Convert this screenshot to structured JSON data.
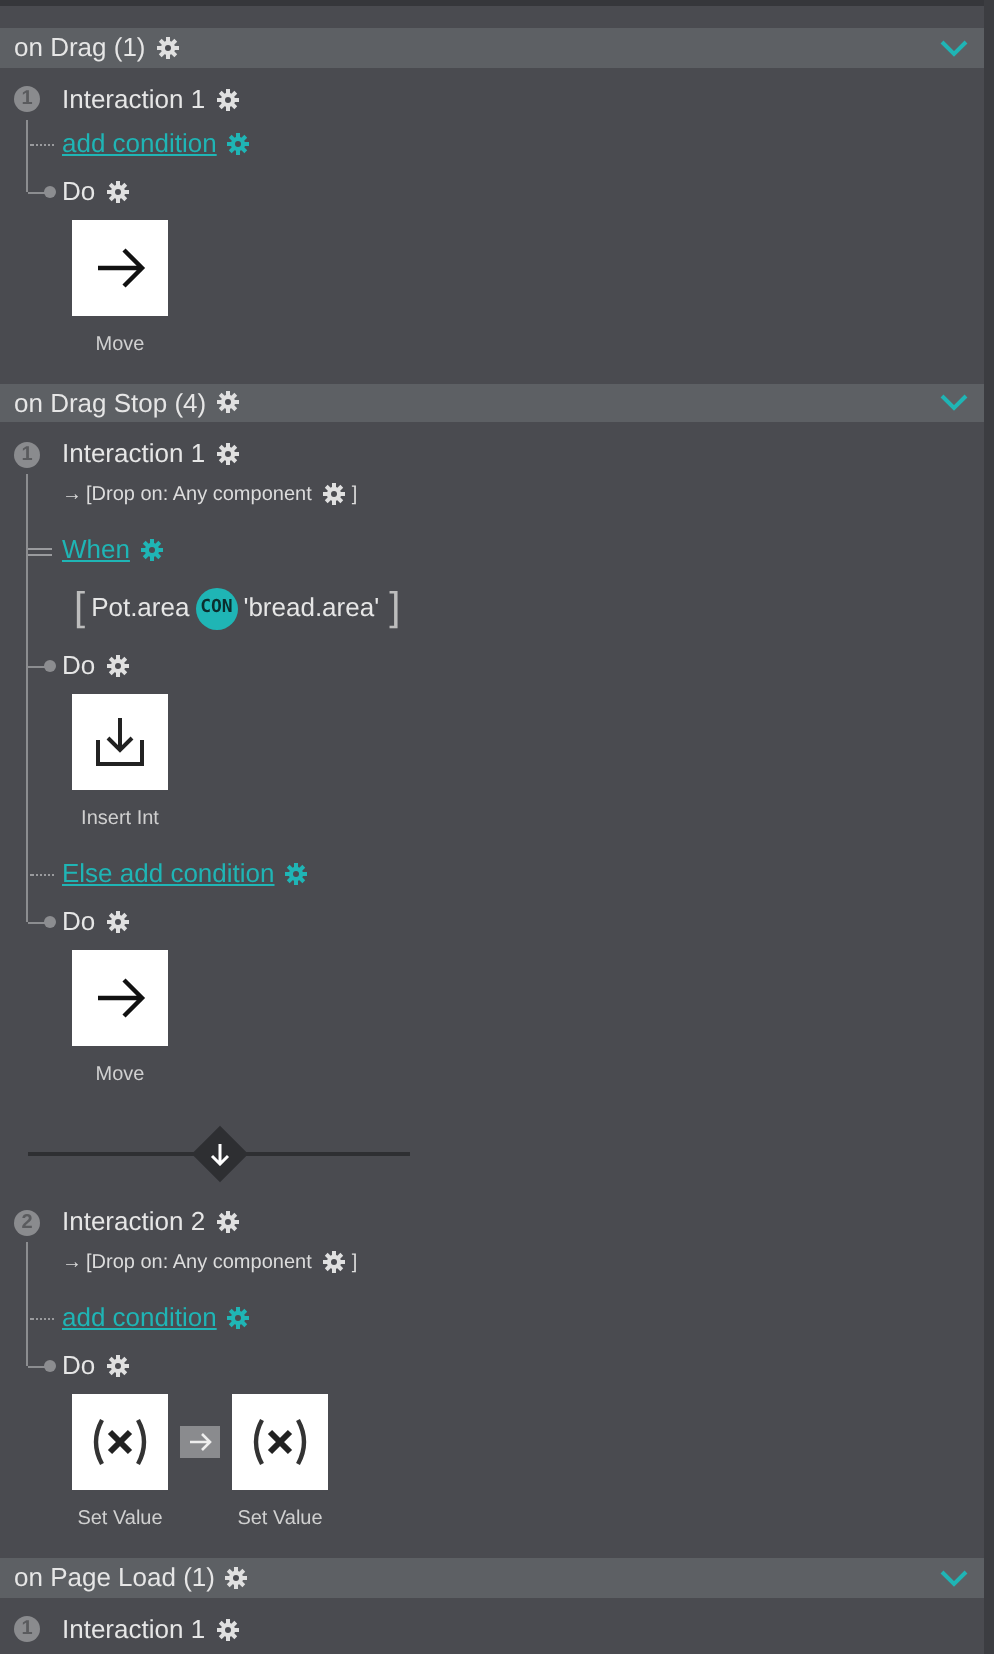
{
  "sections": [
    {
      "title": "on Drag (1)",
      "expanded": true,
      "interactions": [
        {
          "number": "1",
          "title": "Interaction 1",
          "rows": [
            {
              "kind": "condition",
              "label": "add condition"
            },
            {
              "kind": "do",
              "label": "Do",
              "actions": [
                {
                  "kind": "arrow",
                  "label": "Move"
                }
              ]
            }
          ]
        }
      ]
    },
    {
      "title": "on Drag Stop (4)",
      "expanded": true,
      "interactions": [
        {
          "number": "1",
          "title": "Interaction 1",
          "trigger_arrow": "→",
          "trigger_open": "[Drop on: Any component",
          "trigger_close": "]",
          "rows": [
            {
              "kind": "when",
              "label": "When"
            },
            {
              "kind": "expression",
              "open": "[",
              "left": "Pot.area",
              "operator": "CON",
              "right": "'bread.area'",
              "close": "]"
            },
            {
              "kind": "do",
              "label": "Do",
              "actions": [
                {
                  "kind": "download",
                  "label": "Insert Int"
                }
              ]
            },
            {
              "kind": "condition",
              "label": "Else add condition"
            },
            {
              "kind": "do",
              "label": "Do",
              "actions": [
                {
                  "kind": "arrow",
                  "label": "Move"
                }
              ]
            }
          ]
        },
        {
          "number": "2",
          "title": "Interaction 2",
          "trigger_arrow": "→",
          "trigger_open": "[Drop on: Any component",
          "trigger_close": "]",
          "rows": [
            {
              "kind": "condition",
              "label": "add condition"
            },
            {
              "kind": "do",
              "label": "Do",
              "actions": [
                {
                  "kind": "variable",
                  "label": "Set Value"
                },
                {
                  "kind": "variable",
                  "label": "Set Value"
                }
              ]
            }
          ]
        }
      ]
    },
    {
      "title": "on Page Load (1)",
      "expanded": true,
      "interactions": [
        {
          "number": "1",
          "title": "Interaction 1"
        }
      ]
    }
  ]
}
